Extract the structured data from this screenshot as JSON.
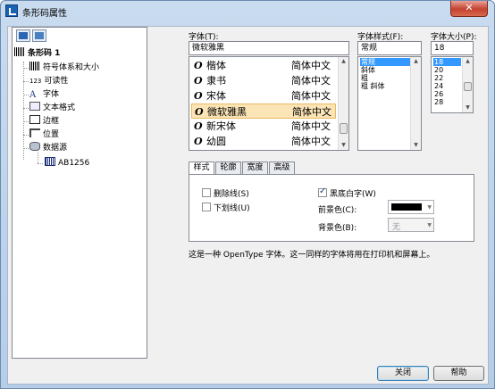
{
  "window": {
    "title": "条形码属性",
    "close_label": "✕"
  },
  "tree": {
    "root": "条形码 1",
    "items": [
      {
        "label": "符号体系和大小",
        "icon": "barcode-icon"
      },
      {
        "label": "可读性",
        "icon": "readability-icon",
        "prefix": "123"
      },
      {
        "label": "字体",
        "icon": "font-icon"
      },
      {
        "label": "文本格式",
        "icon": "text-format-icon"
      },
      {
        "label": "边框",
        "icon": "border-icon"
      },
      {
        "label": "位置",
        "icon": "position-icon"
      },
      {
        "label": "数据源",
        "icon": "database-icon"
      }
    ],
    "datasource_child": "AB1256"
  },
  "font": {
    "label": "字体(T):",
    "value": "微软雅黑",
    "list": [
      {
        "name": "楷体",
        "script": "简体中文"
      },
      {
        "name": "隶书",
        "script": "简体中文"
      },
      {
        "name": "宋体",
        "script": "简体中文"
      },
      {
        "name": "微软雅黑",
        "script": "简体中文"
      },
      {
        "name": "新宋体",
        "script": "简体中文"
      },
      {
        "name": "幼圆",
        "script": "简体中文"
      }
    ],
    "selected_index": 3
  },
  "font_style": {
    "label": "字体样式(F):",
    "value": "常规",
    "list": [
      "常规",
      "斜体",
      "粗",
      "粗 斜体"
    ],
    "selected_index": 0
  },
  "font_size": {
    "label": "字体大小(P):",
    "value": "18",
    "list": [
      "18",
      "20",
      "22",
      "24",
      "26",
      "28"
    ],
    "selected_index": 0
  },
  "tabs": [
    "样式",
    "轮廓",
    "宽度",
    "高级"
  ],
  "style_tab": {
    "strikeout": {
      "label": "删除线(S)",
      "checked": false
    },
    "underline": {
      "label": "下划线(U)",
      "checked": false
    },
    "white_on_black": {
      "label": "黑底白字(W)",
      "checked": true
    },
    "foreground_label": "前景色(C):",
    "foreground_color": "#000000",
    "background_label": "背景色(B):",
    "background_value": "无"
  },
  "description": "这是一种 OpenType 字体。这一同样的字体将用在打印机和屏幕上。",
  "buttons": {
    "close": "关闭",
    "help": "帮助"
  }
}
